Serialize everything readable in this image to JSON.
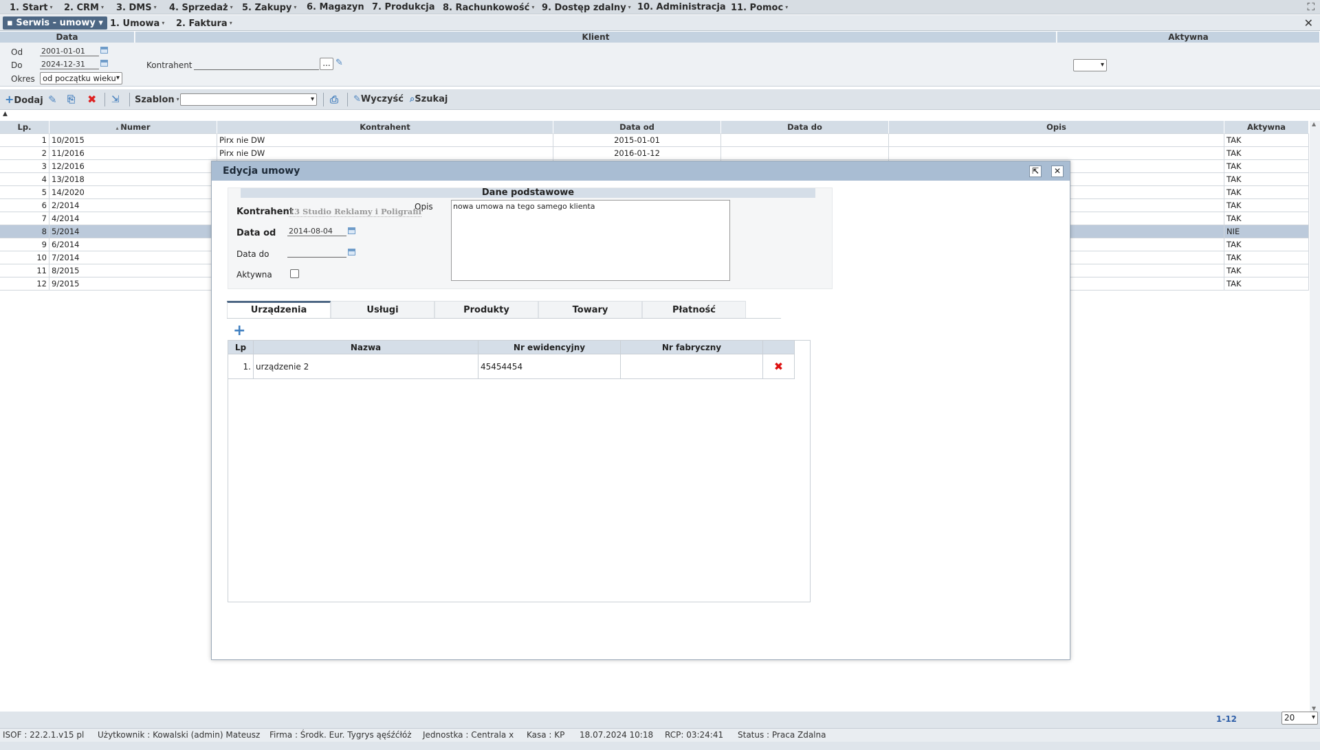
{
  "menu": {
    "items": [
      "1. Start",
      "2. CRM",
      "3. DMS",
      "4. Sprzedaż",
      "5. Zakupy",
      "6. Magazyn",
      "7. Produkcja",
      "8. Rachunkowość",
      "9. Dostęp zdalny",
      "10. Administracja",
      "11. Pomoc"
    ]
  },
  "subtabs": {
    "active": "Serwis - umowy",
    "items": [
      "1. Umowa",
      "2. Faktura"
    ]
  },
  "filters": {
    "data_header": "Data",
    "klient_header": "Klient",
    "aktywna_header": "Aktywna",
    "od_label": "Od",
    "od_value": "2001-01-01",
    "do_label": "Do",
    "do_value": "2024-12-31",
    "okres_label": "Okres",
    "okres_value": "od początku wieku",
    "kontrahent_label": "Kontrahent",
    "kontrahent_value": "",
    "browse_label": "...",
    "aktywna_value": ""
  },
  "toolbar": {
    "add": "Dodaj",
    "template": "Szablon",
    "template_value": "",
    "clear": "Wyczyść",
    "search": "Szukaj"
  },
  "grid": {
    "columns": [
      "Lp.",
      "Numer",
      "Kontrahent",
      "Data od",
      "Data do",
      "Opis",
      "Aktywna"
    ],
    "rows": [
      {
        "lp": "1",
        "numer": "10/2015",
        "kontrahent": "Pirx nie DW",
        "data_od": "2015-01-01",
        "data_do": "",
        "opis": "",
        "aktywna": "TAK"
      },
      {
        "lp": "2",
        "numer": "11/2016",
        "kontrahent": "Pirx nie DW",
        "data_od": "2016-01-12",
        "data_do": "",
        "opis": "",
        "aktywna": "TAK"
      },
      {
        "lp": "3",
        "numer": "12/2016",
        "kontrahent": "",
        "data_od": "",
        "data_do": "",
        "opis": "",
        "aktywna": "TAK"
      },
      {
        "lp": "4",
        "numer": "13/2018",
        "kontrahent": "",
        "data_od": "",
        "data_do": "",
        "opis": "",
        "aktywna": "TAK"
      },
      {
        "lp": "5",
        "numer": "14/2020",
        "kontrahent": "",
        "data_od": "",
        "data_do": "",
        "opis": "",
        "aktywna": "TAK"
      },
      {
        "lp": "6",
        "numer": "2/2014",
        "kontrahent": "",
        "data_od": "",
        "data_do": "",
        "opis": "",
        "aktywna": "TAK"
      },
      {
        "lp": "7",
        "numer": "4/2014",
        "kontrahent": "",
        "data_od": "",
        "data_do": "",
        "opis": "",
        "aktywna": "TAK"
      },
      {
        "lp": "8",
        "numer": "5/2014",
        "kontrahent": "",
        "data_od": "",
        "data_do": "",
        "opis": "",
        "aktywna": "NIE"
      },
      {
        "lp": "9",
        "numer": "6/2014",
        "kontrahent": "",
        "data_od": "",
        "data_do": "",
        "opis": "",
        "aktywna": "TAK"
      },
      {
        "lp": "10",
        "numer": "7/2014",
        "kontrahent": "",
        "data_od": "",
        "data_do": "",
        "opis": "",
        "aktywna": "TAK"
      },
      {
        "lp": "11",
        "numer": "8/2015",
        "kontrahent": "",
        "data_od": "",
        "data_do": "",
        "opis": "",
        "aktywna": "TAK"
      },
      {
        "lp": "12",
        "numer": "9/2015",
        "kontrahent": "",
        "data_od": "",
        "data_do": "",
        "opis": "",
        "aktywna": "TAK"
      }
    ]
  },
  "modal": {
    "title": "Edycja umowy",
    "section_title": "Dane podstawowe",
    "kontrahent_label": "Kontrahent",
    "kontrahent_value": "13 Studio Reklamy i Poligrafii",
    "data_od_label": "Data od",
    "data_od_value": "2014-08-04",
    "data_do_label": "Data do",
    "data_do_value": "",
    "aktywna_label": "Aktywna",
    "opis_label": "Opis",
    "opis_value": "nowa umowa na tego samego klienta",
    "tabs": [
      "Urządzenia",
      "Usługi",
      "Produkty",
      "Towary",
      "Płatność"
    ],
    "devices": {
      "columns": [
        "Lp",
        "Nazwa",
        "Nr ewidencyjny",
        "Nr fabryczny"
      ],
      "rows": [
        {
          "lp": "1.",
          "nazwa": "urządzenie 2",
          "nr_ewid": "45454454",
          "nr_fabr": ""
        }
      ]
    }
  },
  "pager": {
    "range": "1-12",
    "page_size": "20"
  },
  "status": {
    "version": "ISOF : 22.2.1.v15 pl",
    "user": "Użytkownik : Kowalski (admin) Mateusz",
    "firm": "Firma : Środk. Eur. Tygrys ąęśźćłóż",
    "unit": "Jednostka : Centrala x",
    "kasa": "Kasa : KP",
    "datetime": "18.07.2024 10:18",
    "rcp": "RCP: 03:24:41",
    "state": "Status : Praca Zdalna"
  }
}
